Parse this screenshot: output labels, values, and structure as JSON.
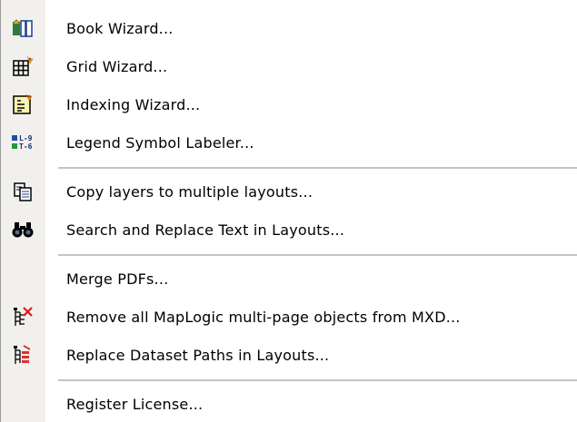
{
  "menu": {
    "items": [
      {
        "label": "Book Wizard...",
        "icon": "book-wizard-icon"
      },
      {
        "label": "Grid Wizard...",
        "icon": "grid-wizard-icon"
      },
      {
        "label": "Indexing Wizard...",
        "icon": "indexing-wizard-icon"
      },
      {
        "label": "Legend Symbol Labeler...",
        "icon": "legend-symbol-icon"
      },
      {
        "label": "Copy layers to multiple layouts...",
        "icon": "copy-layers-icon"
      },
      {
        "label": "Search and Replace Text in Layouts...",
        "icon": "binoculars-icon"
      },
      {
        "label": "Merge PDFs...",
        "icon": ""
      },
      {
        "label": "Remove all MapLogic multi-page objects from MXD...",
        "icon": "remove-objects-icon"
      },
      {
        "label": "Replace Dataset Paths in Layouts...",
        "icon": "replace-paths-icon"
      },
      {
        "label": "Register License...",
        "icon": ""
      }
    ],
    "legend_icon_text": [
      "L-9",
      "T-6"
    ]
  },
  "colors": {
    "gutter": "#f1f0ec",
    "separator": "#c4c4c4"
  }
}
